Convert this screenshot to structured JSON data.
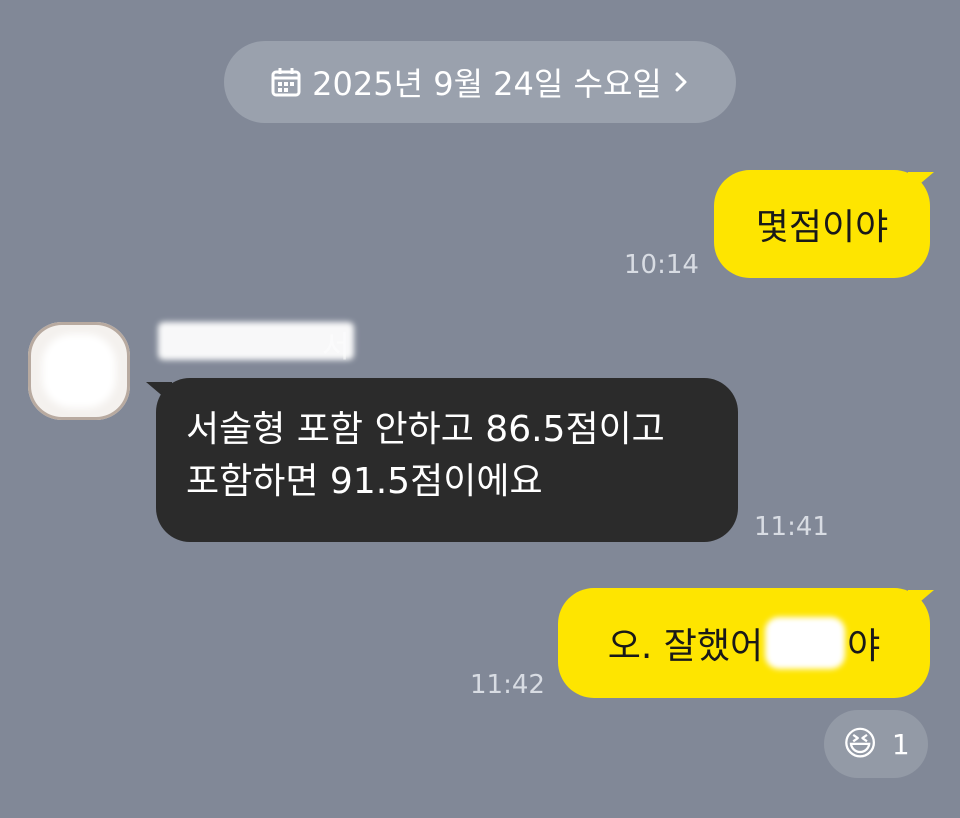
{
  "date_header": {
    "label": "2025년 9월 24일 수요일",
    "icon": "calendar-icon",
    "chevron": "chevron-right-icon"
  },
  "messages": [
    {
      "side": "out",
      "text": "몇점이야",
      "time": "10:14"
    },
    {
      "side": "in",
      "sender": "서",
      "text": "서술형 포함 안하고 86.5점이고 포함하면 91.5점이에요",
      "time": "11:41"
    },
    {
      "side": "out",
      "text_before": "오. 잘했어",
      "text_after": "야",
      "time": "11:42"
    }
  ],
  "reaction": {
    "emoji": "😆",
    "count": "1"
  },
  "colors": {
    "background": "#818897",
    "outgoing_bubble": "#fee500",
    "incoming_bubble": "#2b2b2b"
  }
}
